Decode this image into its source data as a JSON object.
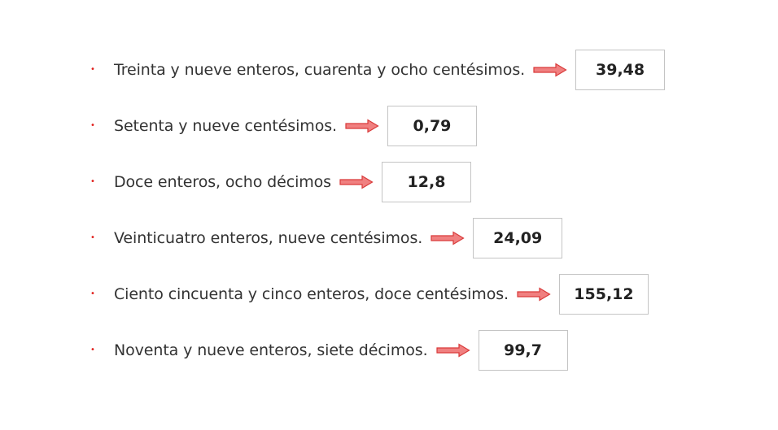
{
  "colors": {
    "bullet": "#e0201c",
    "arrow_fill": "#f08080",
    "arrow_stroke": "#d93a3a",
    "text": "#333333",
    "box_border": "#c4c4c4"
  },
  "items": [
    {
      "bullet": "•",
      "phrase": "Treinta y nueve enteros, cuarenta y ocho centésimos.",
      "icon": "right-arrow-icon",
      "answer": "39,48"
    },
    {
      "bullet": "•",
      "phrase": "Setenta y nueve centésimos.",
      "icon": "right-arrow-icon",
      "answer": "0,79"
    },
    {
      "bullet": "•",
      "phrase": "Doce enteros, ocho décimos",
      "icon": "right-arrow-icon",
      "answer": "12,8"
    },
    {
      "bullet": "•",
      "phrase": "Veinticuatro enteros, nueve centésimos.",
      "icon": "right-arrow-icon",
      "answer": "24,09"
    },
    {
      "bullet": "•",
      "phrase": "Ciento cincuenta y cinco enteros, doce centésimos.",
      "icon": "right-arrow-icon",
      "answer": "155,12"
    },
    {
      "bullet": "•",
      "phrase": "Noventa y nueve enteros, siete décimos.",
      "icon": "right-arrow-icon",
      "answer": "99,7"
    }
  ]
}
